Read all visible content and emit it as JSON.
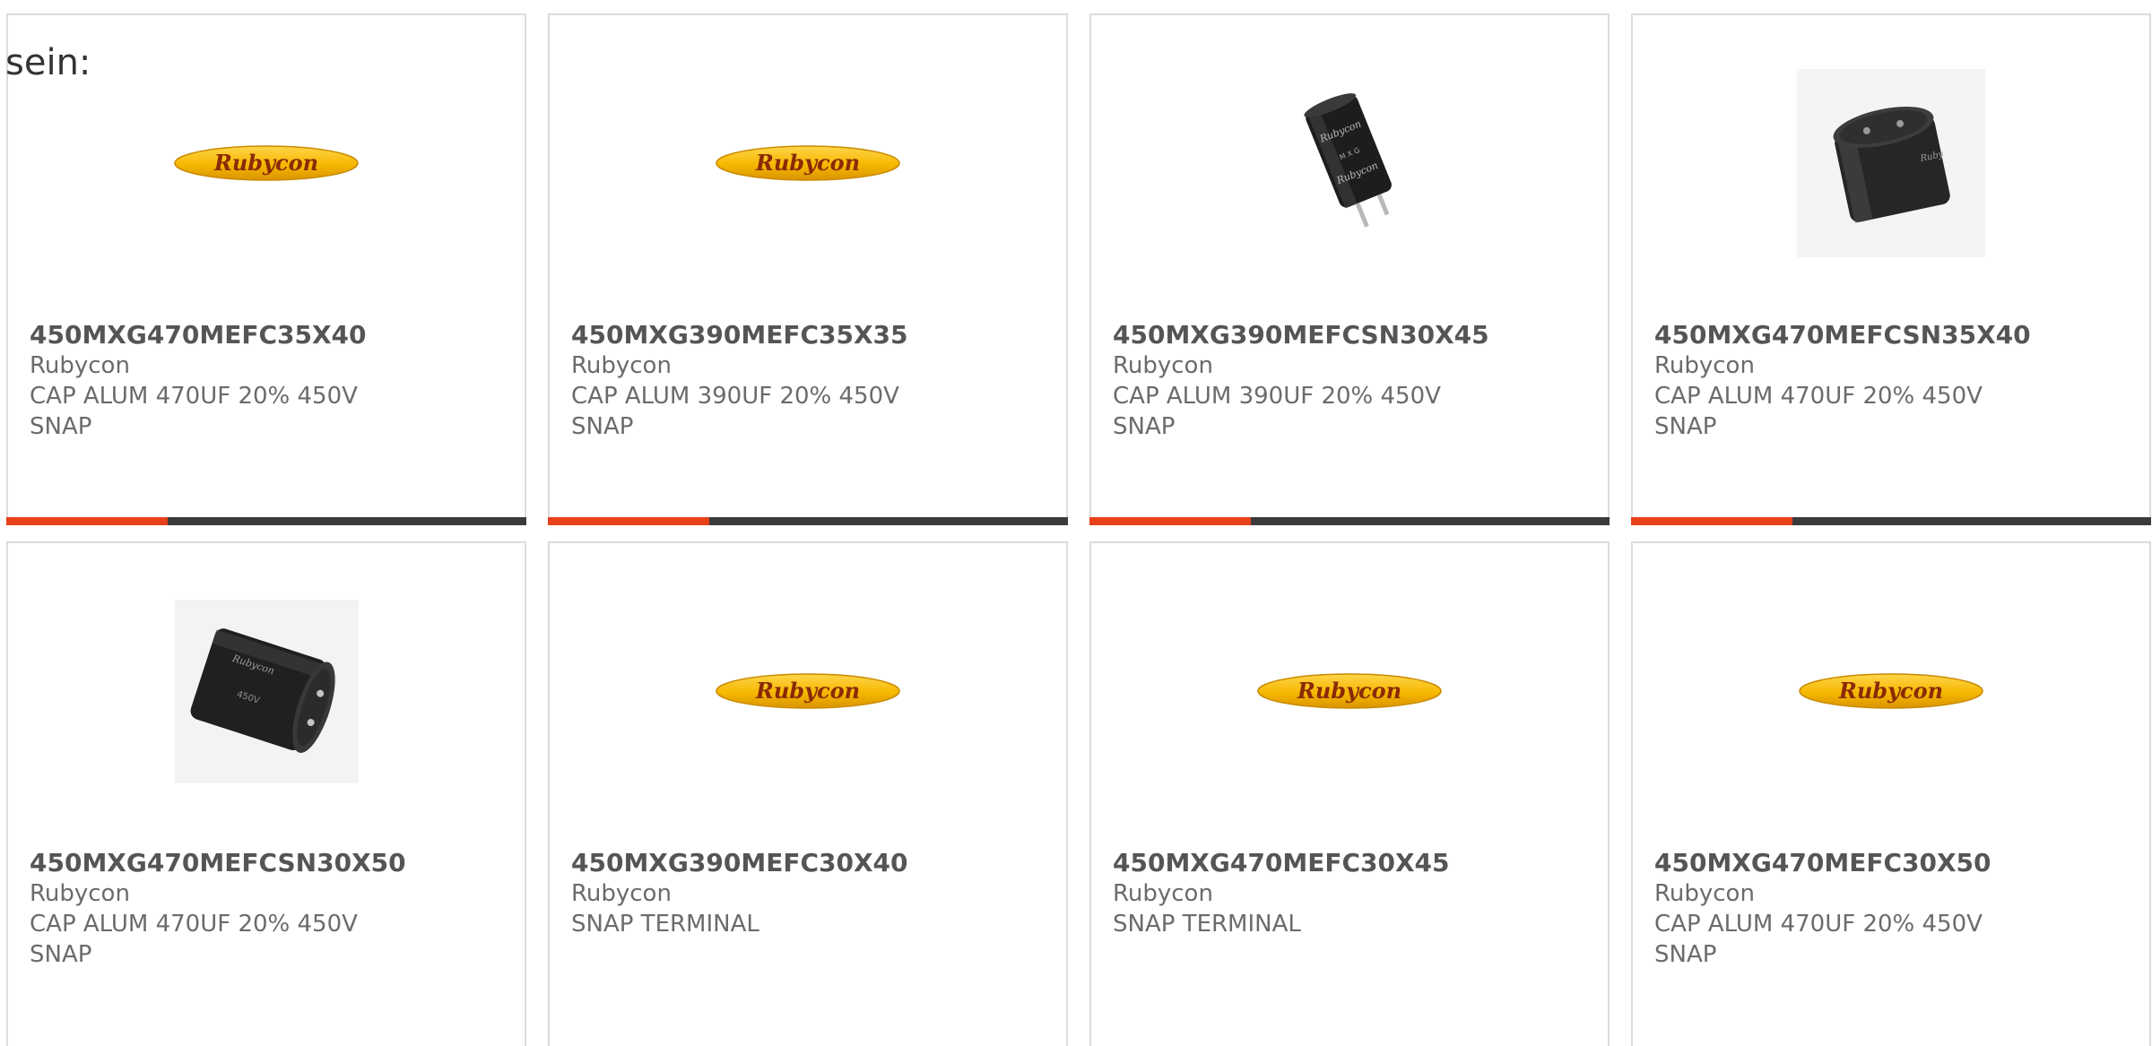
{
  "intro_text": "sein:",
  "colors": {
    "accent": "#e8411a",
    "bar_dark": "#3a3a3a",
    "logo_yellow": "#f5b800",
    "logo_text": "#8a2a06"
  },
  "products": [
    {
      "part_number": "450MXG470MEFC35X40",
      "manufacturer": "Rubycon",
      "description_lines": [
        "CAP ALUM 470UF 20% 450V",
        "SNAP"
      ],
      "image": "rubycon-logo",
      "logo_text": "Rubycon",
      "accent_fraction": 0.31
    },
    {
      "part_number": "450MXG390MEFC35X35",
      "manufacturer": "Rubycon",
      "description_lines": [
        "CAP ALUM 390UF 20% 450V",
        "SNAP"
      ],
      "image": "rubycon-logo",
      "logo_text": "Rubycon",
      "accent_fraction": 0.31
    },
    {
      "part_number": "450MXG390MEFCSN30X45",
      "manufacturer": "Rubycon",
      "description_lines": [
        "CAP ALUM 390UF 20% 450V",
        "SNAP"
      ],
      "image": "capacitor-tall-photo",
      "accent_fraction": 0.31
    },
    {
      "part_number": "450MXG470MEFCSN35X40",
      "manufacturer": "Rubycon",
      "description_lines": [
        "CAP ALUM 470UF 20% 450V",
        "SNAP"
      ],
      "image": "capacitor-squat-photo",
      "accent_fraction": 0.31
    },
    {
      "part_number": "450MXG470MEFCSN30X50",
      "manufacturer": "Rubycon",
      "description_lines": [
        "CAP ALUM 470UF 20% 450V",
        "SNAP"
      ],
      "image": "capacitor-lying-photo"
    },
    {
      "part_number": "450MXG390MEFC30X40",
      "manufacturer": "Rubycon",
      "description_lines": [
        "SNAP TERMINAL"
      ],
      "image": "rubycon-logo",
      "logo_text": "Rubycon"
    },
    {
      "part_number": "450MXG470MEFC30X45",
      "manufacturer": "Rubycon",
      "description_lines": [
        "SNAP TERMINAL"
      ],
      "image": "rubycon-logo",
      "logo_text": "Rubycon"
    },
    {
      "part_number": "450MXG470MEFC30X50",
      "manufacturer": "Rubycon",
      "description_lines": [
        "CAP ALUM 470UF 20% 450V",
        "SNAP"
      ],
      "image": "rubycon-logo",
      "logo_text": "Rubycon"
    }
  ]
}
